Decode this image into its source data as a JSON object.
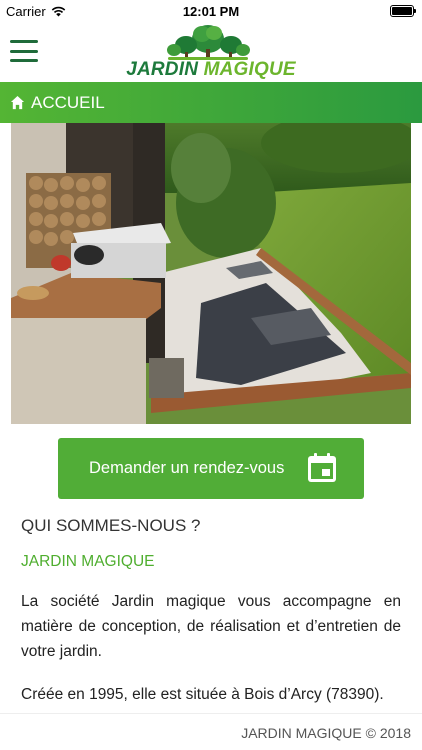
{
  "status_bar": {
    "carrier": "Carrier",
    "time": "12:01 PM",
    "wifi_icon": "wifi-icon",
    "battery_icon": "battery-icon"
  },
  "header": {
    "menu_icon": "hamburger-menu-icon",
    "logo": {
      "word1": "JARDIN",
      "word2": "MAGIQUE"
    }
  },
  "nav": {
    "icon": "home-icon",
    "label": "ACCUEIL"
  },
  "hero": {
    "image": "garden-photo"
  },
  "cta": {
    "label": "Demander un rendez-vous",
    "icon": "calendar-icon"
  },
  "about": {
    "title": "QUI SOMMES-NOUS ?",
    "subtitle": "JARDIN MAGIQUE",
    "paragraph1": "La société Jardin magique vous accompagne en matière de conception, de réalisation et d’entretien de votre jardin.",
    "paragraph2": "Créée en 1995, elle est située à Bois d’Arcy (78390)."
  },
  "footer": {
    "copyright": "JARDIN MAGIQUE © 2018"
  },
  "colors": {
    "brand_dark_green": "#1d7a3c",
    "brand_light_green": "#6cb52d",
    "nav_gradient_start": "#54b534",
    "nav_gradient_end": "#2b9a3f",
    "cta_green": "#51ad37",
    "subtitle_green": "#4fae2f"
  }
}
